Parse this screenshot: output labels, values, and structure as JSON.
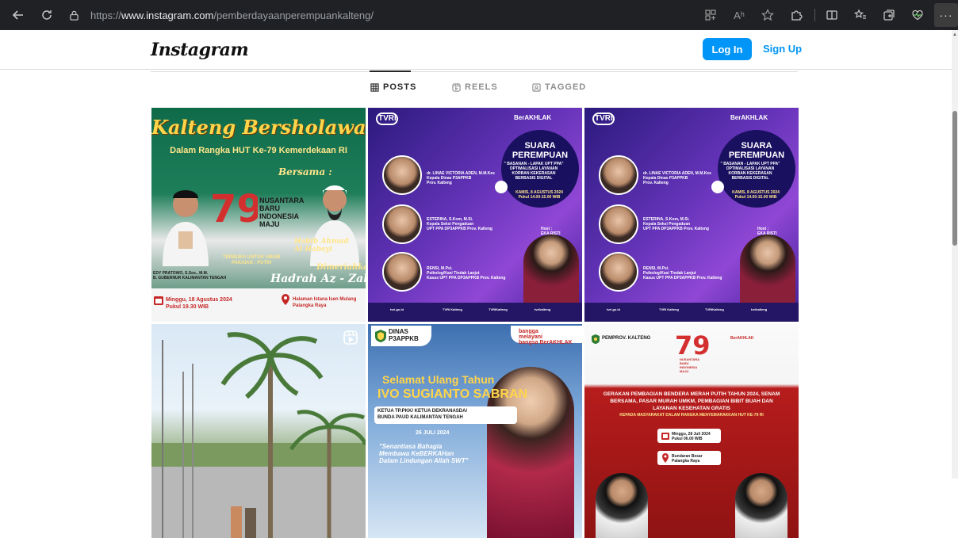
{
  "browser": {
    "url_scheme": "https://",
    "url_host": "www.instagram.com",
    "url_path": "/pemberdayaanperempuankalteng/",
    "reader_label": "Aʰ",
    "more_label": "···"
  },
  "header": {
    "logo": "Instagram",
    "login_label": "Log In",
    "signup_label": "Sign Up"
  },
  "tabs": [
    {
      "label": "POSTS",
      "active": true
    },
    {
      "label": "REELS",
      "active": false
    },
    {
      "label": "TAGGED",
      "active": false
    }
  ],
  "posts": {
    "p1": {
      "title": "Kalteng Bersholawat",
      "subtitle": "Dalam Rangka HUT Ke-79 Kemerdekaan RI",
      "bersama": "Bersama :",
      "nusantara": "NUSANTARA\nBARU\nINDONESIA\nMAJU",
      "habib": "Habib Ahmad\nAl Habsyi",
      "terbuka": "TERBUKA UNTUK UMUM\nPAKAIAN : PUTIH",
      "edy": "EDY PRATOWO, S.Sos., M.M.\nB. GUBERNUR KALIMANTAN TENGAH",
      "dimeriahkan": "Dimeriahkan",
      "hadrah": "Hadrah Az - Zahir",
      "date": "Minggu, 18 Agustus 2024\nPukul 19.30 WIB",
      "place": "Halaman Istana Isen Mulang\nPalangka Raya"
    },
    "p2": {
      "tvri": "TVRI",
      "berakhlak": "BerAKHLAK",
      "suara": "SUARA\nPEREMPUAN",
      "basanan": "\" BASANAN - LAPAK UPT PPA\"\nOPTIMALISASI LAYANAN\nKORBAN KEKERASAN\nBERBASIS DIGITAL",
      "kamis": "KAMIS, 8 AGUSTUS 2024\nPukul 14.00-15.00 WIB",
      "n1": "dr. LINAE VICTORIA ADEN, M.M.Kes\nKepala Dinas P3APPKB\nProv. Kalteng",
      "n2": "ESTERINA, S.Kom, M.Si.\nKepala Seksi Pengaduan\nUPT PPA DP3APPKB Prov. Kalteng",
      "n3": "RENSI, M.Psi.\nPsikolog/Kasi Tindak Lanjut\nKasus UPT PPA DP3APPKB Prov. Kalteng",
      "host": "Host :\nEKA RISTI",
      "soc1": "tvri.go.id",
      "soc2": "TVRI Kalteng",
      "soc3": "TVRIKalteng",
      "soc4": "tvrikalteng"
    },
    "p3": {
      "tvri": "TVRI",
      "berakhlak": "BerAKHLAK",
      "suara": "SUARA\nPEREMPUAN",
      "basanan": "\" BASANAN - LAPAK UPT PPA\"\nOPTIMALISASI LAYANAN\nKORBAN KEKERASAN\nBERBASIS DIGITAL",
      "kamis": "KAMIS, 8 AGUSTUS 2024\nPukul 14.00-15.00 WIB",
      "n1": "dr. LINAE VICTORIA ADEN, M.M.Kes\nKepala Dinas P3APPKB\nProv. Kalteng",
      "n2": "ESTERINA, S.Kom, M.Si.\nKepala Seksi Pengaduan\nUPT PPA DP3APPKB Prov. Kalteng",
      "n3": "RENSI, M.Psi.\nPsikolog/Kasi Tindak Lanjut\nKasus UPT PPA DP3APPKB Prov. Kalteng",
      "host": "Host :\nEKA RISTI",
      "soc1": "tvri.go.id",
      "soc2": "TVRI Kalteng",
      "soc3": "TVRIKalteng",
      "soc4": "tvrikalteng"
    },
    "p5": {
      "dinas": "DINAS\nP3APPKB",
      "bb": "bangga\nmelayani\nbangsa BerAKHLAK",
      "selamat": "Selamat Ulang Tahun",
      "ivo": "IVO SUGIANTO SABRAN",
      "ketua": "KETUA TP.PKK/ KETUA DEKRANASDA/\nBUNDA PAUD KALIMANTAN TENGAH",
      "tgl": "26 JULI 2024",
      "quote": "\"Senantiasa Bahagia\nMembawa KeBERKAHan\nDalam Lindungan Allah SWT\""
    },
    "p6": {
      "pemprov": "PEMPROV. KALTENG",
      "nus": "NUSANTARA\nBARU\nINDONESIA\nMAJU",
      "berakh": "BerAKHLAK",
      "gerakan": "GERAKAN PEMBAGIAN BENDERA MERAH PUTIH TAHUN 2024, SENAM BERSAMA, PASAR MURAH UMKM, PEMBAGIAN BIBIT BUAH DAN LAYANAN KESEHATAN GRATIS",
      "kepada": "KEPADA MASYARAKAT DALAM RANGKA MENYEMARAKKAN HUT KE-79 RI",
      "tanggal": "Minggu, 28 Juli 2024\nPukul 06.00 WIB",
      "lokasi": "Bundaran Besar\nPalangka Raya"
    }
  },
  "colors": {
    "accent": "#0095f6",
    "browser_bg": "#202124"
  }
}
